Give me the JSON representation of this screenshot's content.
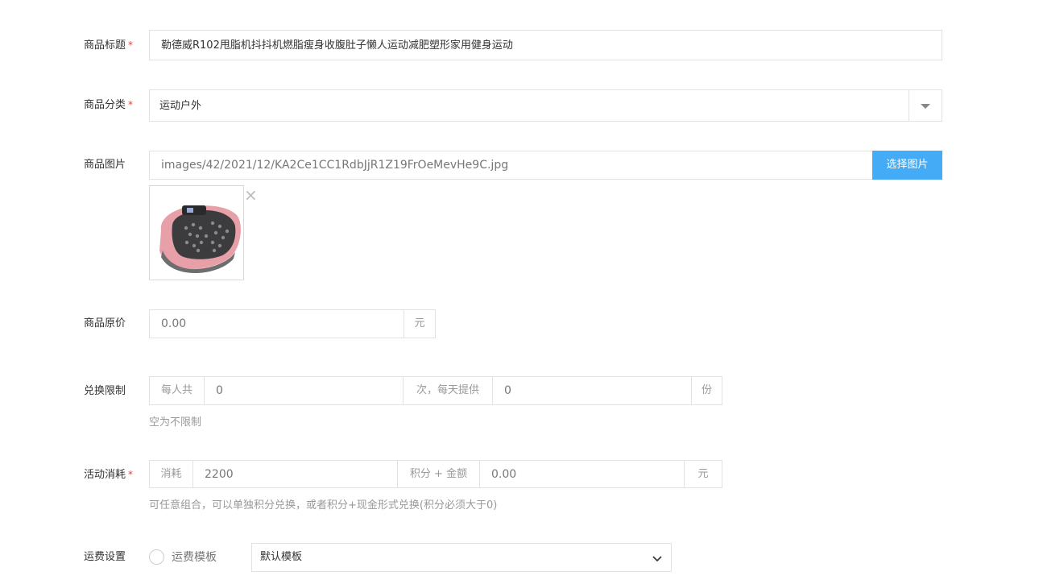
{
  "form": {
    "title": {
      "label": "商品标题",
      "required_mark": "*",
      "value": "勒德威R102甩脂机抖抖机燃脂瘦身收腹肚子懒人运动减肥塑形家用健身运动"
    },
    "category": {
      "label": "商品分类",
      "required_mark": "*",
      "value": "运动户外",
      "icon": "caret-down-icon"
    },
    "image": {
      "label": "商品图片",
      "path": "images/42/2021/12/KA2Ce1CC1RdbJjR1Z19FrOeMevHe9C.jpg",
      "select_label": "选择图片",
      "remove_glyph": "×",
      "thumb_icon": "vibration-plate-icon"
    },
    "original_price": {
      "label": "商品原价",
      "value": "0.00",
      "unit": "元"
    },
    "exchange_limit": {
      "label": "兑换限制",
      "prefix": "每人共",
      "per_person": "0",
      "middle": "次，每天提供",
      "per_day": "0",
      "unit": "份",
      "help": "空为不限制"
    },
    "consumption": {
      "label": "活动消耗",
      "required_mark": "*",
      "prefix": "消耗",
      "points": "2200",
      "middle": "积分 + 金额",
      "amount": "0.00",
      "unit": "元",
      "help": "可任意组合，可以单独积分兑换，或者积分+现金形式兑换(积分必须大于0)"
    },
    "shipping": {
      "label": "运费设置",
      "radio_label": "运费模板",
      "template_value": "默认模板",
      "icon": "chevron-down-icon"
    }
  }
}
